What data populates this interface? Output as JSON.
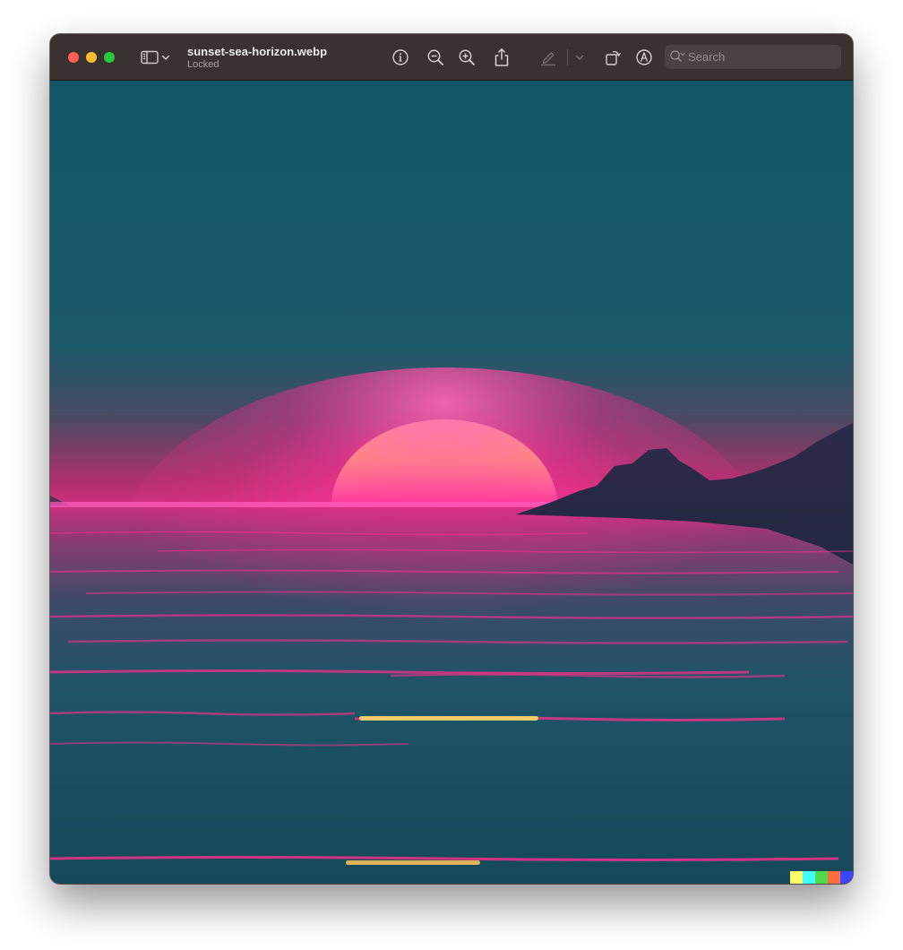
{
  "window": {
    "file_name": "sunset-sea-horizon.webp",
    "status": "Locked"
  },
  "toolbar": {
    "sidebar_toggle": "sidebar-icon",
    "sidebar_menu": "chevron-down-icon",
    "info": "info-icon",
    "zoom_out": "zoom-out-icon",
    "zoom_in": "zoom-in-icon",
    "share": "share-icon",
    "markup": "highlighter-icon",
    "markup_menu": "chevron-down-icon",
    "rotate": "rotate-icon",
    "annotate": "markup-icon"
  },
  "search": {
    "placeholder": "Search",
    "value": ""
  },
  "image": {
    "subject": "sunset over sea with mountain silhouette",
    "colors": {
      "sky_top": "#125569",
      "sky_horizon": "#ff2f9a",
      "sun_top": "#fff2a6",
      "sun_bottom": "#ff3a9e",
      "mountain": "#2a2846",
      "water": "#17505f",
      "water_highlight": "#ff2d8f"
    },
    "watermark_colors": [
      "#ffff66",
      "#42ffff",
      "#51da4c",
      "#ff6e3c",
      "#3c46ff"
    ]
  }
}
